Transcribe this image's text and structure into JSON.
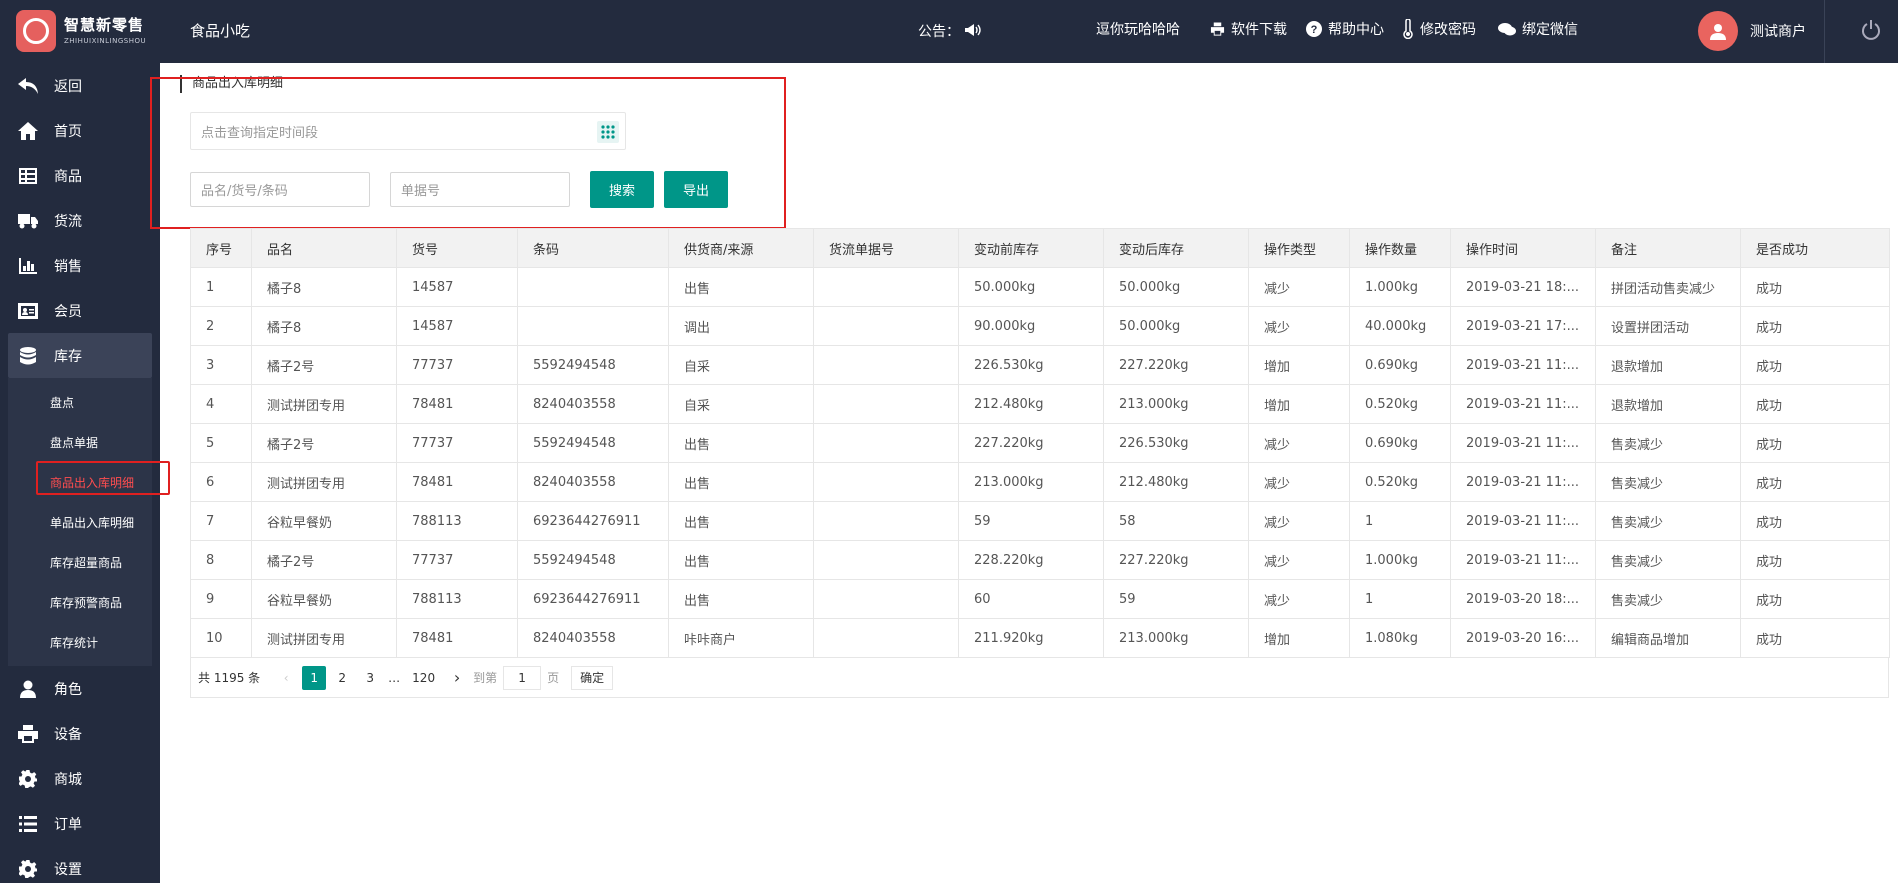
{
  "header": {
    "brand_cn": "智慧新零售",
    "brand_en": "ZHIHUIXINLINGSHOU",
    "store_name": "食品小吃",
    "notice_label": "公告：",
    "marquee_text": "逗你玩哈哈哈",
    "links": [
      "软件下载",
      "帮助中心",
      "修改密码",
      "绑定微信"
    ],
    "user_name": "测试商户"
  },
  "sidebar": {
    "items": [
      {
        "label": "返回",
        "icon": "back-icon"
      },
      {
        "label": "首页",
        "icon": "home-icon"
      },
      {
        "label": "商品",
        "icon": "grid-icon"
      },
      {
        "label": "货流",
        "icon": "truck-icon"
      },
      {
        "label": "销售",
        "icon": "bar-chart-icon"
      },
      {
        "label": "会员",
        "icon": "member-card-icon"
      },
      {
        "label": "库存",
        "icon": "database-icon"
      }
    ],
    "sub_items": [
      "盘点",
      "盘点单据",
      "商品出入库明细",
      "单品出入库明细",
      "库存超量商品",
      "库存预警商品",
      "库存统计"
    ],
    "items_after": [
      {
        "label": "角色",
        "icon": "user-icon"
      },
      {
        "label": "设备",
        "icon": "printer-icon"
      },
      {
        "label": "商城",
        "icon": "gear-icon"
      },
      {
        "label": "订单",
        "icon": "list-icon"
      },
      {
        "label": "设置",
        "icon": "settings-icon"
      }
    ]
  },
  "main": {
    "breadcrumb": "商品出入库明细",
    "date_placeholder": "点击查询指定时间段",
    "name_placeholder": "品名/货号/条码",
    "doc_placeholder": "单据号",
    "search_label": "搜索",
    "export_label": "导出",
    "table": {
      "headers": [
        "序号",
        "品名",
        "货号",
        "条码",
        "供货商/来源",
        "货流单据号",
        "变动前库存",
        "变动后库存",
        "操作类型",
        "操作数量",
        "操作时间",
        "备注",
        "是否成功"
      ],
      "rows": [
        [
          "1",
          "橘子8",
          "14587",
          "",
          "出售",
          "",
          "50.000kg",
          "50.000kg",
          "减少",
          "1.000kg",
          "2019-03-21 18:...",
          "拼团活动售卖减少",
          "成功"
        ],
        [
          "2",
          "橘子8",
          "14587",
          "",
          "调出",
          "",
          "90.000kg",
          "50.000kg",
          "减少",
          "40.000kg",
          "2019-03-21 17:...",
          "设置拼团活动",
          "成功"
        ],
        [
          "3",
          "橘子2号",
          "77737",
          "5592494548",
          "自采",
          "",
          "226.530kg",
          "227.220kg",
          "增加",
          "0.690kg",
          "2019-03-21 11:...",
          "退款增加",
          "成功"
        ],
        [
          "4",
          "测试拼团专用",
          "78481",
          "8240403558",
          "自采",
          "",
          "212.480kg",
          "213.000kg",
          "增加",
          "0.520kg",
          "2019-03-21 11:...",
          "退款增加",
          "成功"
        ],
        [
          "5",
          "橘子2号",
          "77737",
          "5592494548",
          "出售",
          "",
          "227.220kg",
          "226.530kg",
          "减少",
          "0.690kg",
          "2019-03-21 11:...",
          "售卖减少",
          "成功"
        ],
        [
          "6",
          "测试拼团专用",
          "78481",
          "8240403558",
          "出售",
          "",
          "213.000kg",
          "212.480kg",
          "减少",
          "0.520kg",
          "2019-03-21 11:...",
          "售卖减少",
          "成功"
        ],
        [
          "7",
          "谷粒早餐奶",
          "788113",
          "6923644276911",
          "出售",
          "",
          "59",
          "58",
          "减少",
          "1",
          "2019-03-21 11:...",
          "售卖减少",
          "成功"
        ],
        [
          "8",
          "橘子2号",
          "77737",
          "5592494548",
          "出售",
          "",
          "228.220kg",
          "227.220kg",
          "减少",
          "1.000kg",
          "2019-03-21 11:...",
          "售卖减少",
          "成功"
        ],
        [
          "9",
          "谷粒早餐奶",
          "788113",
          "6923644276911",
          "出售",
          "",
          "60",
          "59",
          "减少",
          "1",
          "2019-03-20 18:...",
          "售卖减少",
          "成功"
        ],
        [
          "10",
          "测试拼团专用",
          "78481",
          "8240403558",
          "咔咔商户",
          "",
          "211.920kg",
          "213.000kg",
          "增加",
          "1.080kg",
          "2019-03-20 16:...",
          "编辑商品增加",
          "成功"
        ]
      ]
    },
    "pager": {
      "total": "共 1195 条",
      "pages": [
        "1",
        "2",
        "3",
        "…",
        "120"
      ],
      "goto_label": "到第",
      "goto_value": "1",
      "page_unit": "页",
      "confirm": "确定"
    }
  },
  "colors": {
    "header_bg": "#232b3e",
    "accent": "#009688",
    "highlight": "#e02020"
  }
}
